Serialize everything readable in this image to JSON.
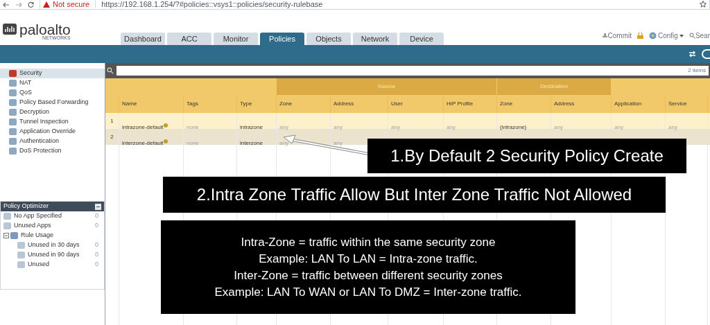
{
  "browser": {
    "security": "Not secure",
    "url": "https://192.168.1.254/?#policies::vsys1::policies/security-rulebase"
  },
  "logo": {
    "name": "paloalto",
    "sub": "NETWORKS"
  },
  "tabs": [
    {
      "label": "Dashboard",
      "selected": false
    },
    {
      "label": "ACC",
      "selected": false
    },
    {
      "label": "Monitor",
      "selected": false
    },
    {
      "label": "Policies",
      "selected": true
    },
    {
      "label": "Objects",
      "selected": false
    },
    {
      "label": "Network",
      "selected": false
    },
    {
      "label": "Device",
      "selected": false
    }
  ],
  "header_actions": {
    "commit": "Commit",
    "config": "Config",
    "search": "Sear"
  },
  "sidebar": {
    "items": [
      {
        "label": "Security",
        "selected": true
      },
      {
        "label": "NAT",
        "selected": false
      },
      {
        "label": "QoS",
        "selected": false
      },
      {
        "label": "Policy Based Forwarding",
        "selected": false
      },
      {
        "label": "Decryption",
        "selected": false
      },
      {
        "label": "Tunnel Inspection",
        "selected": false
      },
      {
        "label": "Application Override",
        "selected": false
      },
      {
        "label": "Authentication",
        "selected": false
      },
      {
        "label": "DoS Protection",
        "selected": false
      }
    ]
  },
  "optimizer": {
    "title": "Policy Optimizer",
    "items": [
      {
        "label": "No App Specified",
        "count": "0"
      },
      {
        "label": "Unused Apps",
        "count": "0"
      },
      {
        "label": "Rule Usage",
        "expanded": true,
        "children": [
          {
            "label": "Unused in 30 days",
            "count": "0"
          },
          {
            "label": "Unused in 90 days",
            "count": "0"
          },
          {
            "label": "Unused",
            "count": "0"
          }
        ]
      }
    ]
  },
  "table": {
    "count": "2 items",
    "groups": [
      {
        "label": "Source"
      },
      {
        "label": "Destination"
      }
    ],
    "columns": [
      "Name",
      "Tags",
      "Type",
      "Zone",
      "Address",
      "User",
      "HIP Profile",
      "Zone",
      "Address",
      "Application",
      "Service"
    ],
    "rows": [
      {
        "num": "1",
        "cells": [
          "intrazone-default",
          "none",
          "intrazone",
          "any",
          "any",
          "any",
          "any",
          "(intrazone)",
          "any",
          "any",
          "any"
        ]
      },
      {
        "num": "2",
        "cells": [
          "interzone-default",
          "none",
          "interzone",
          "any",
          "any"
        ]
      }
    ]
  },
  "callouts": [
    {
      "kind": "title",
      "text": "1.By Default 2 Security Policy Create"
    },
    {
      "kind": "title",
      "text": "2.Intra Zone Traffic Allow But Inter Zone Traffic Not Allowed"
    },
    {
      "kind": "note",
      "lines": [
        "Intra-Zone = traffic within the same security zone",
        "Example: LAN To LAN = Intra-zone traffic.",
        "Inter-Zone = traffic between different security zones",
        "Example: LAN To WAN or LAN To DMZ = Inter-zone traffic."
      ]
    }
  ]
}
